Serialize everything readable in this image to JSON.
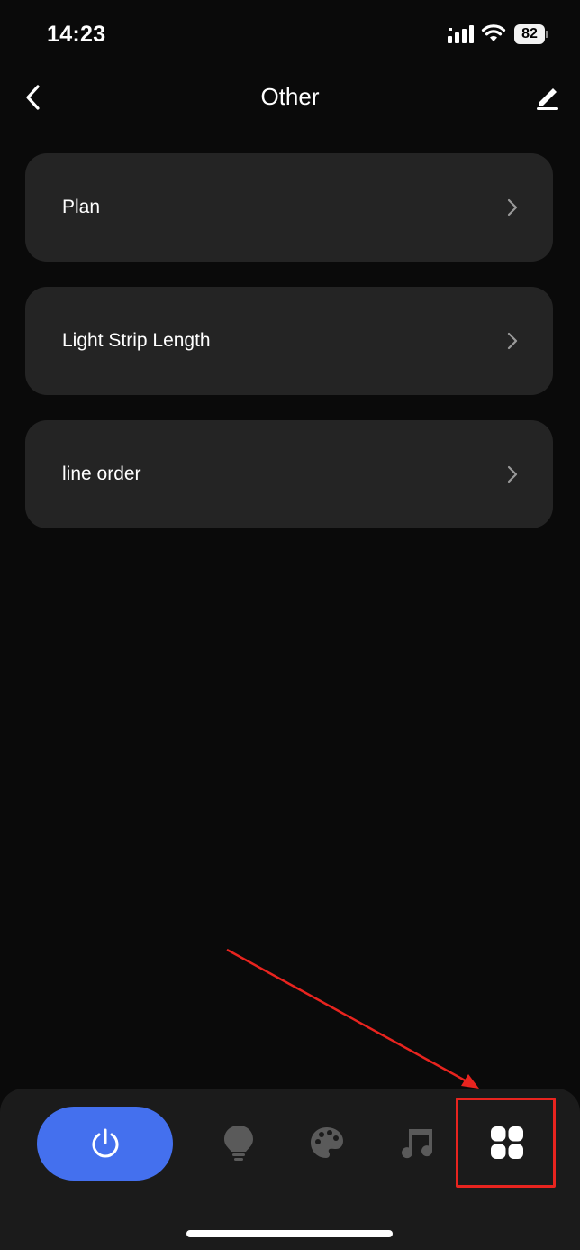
{
  "status_bar": {
    "time": "14:23",
    "battery_level": "82",
    "icons": [
      "signal-icon",
      "wifi-icon",
      "battery-icon"
    ]
  },
  "header": {
    "title": "Other",
    "back_icon": "chevron-left-icon",
    "edit_icon": "pencil-icon"
  },
  "menu": {
    "items": [
      {
        "label": "Plan"
      },
      {
        "label": "Light Strip Length"
      },
      {
        "label": "line order"
      }
    ]
  },
  "bottom_nav": {
    "tabs": [
      {
        "icon": "power-icon",
        "active": false
      },
      {
        "icon": "lightbulb-icon",
        "active": false
      },
      {
        "icon": "palette-icon",
        "active": false
      },
      {
        "icon": "music-note-icon",
        "active": false
      },
      {
        "icon": "grid-icon",
        "active": true
      }
    ]
  },
  "colors": {
    "background": "#0a0a0a",
    "card": "#242424",
    "nav_background": "#1b1b1b",
    "accent": "#4470ee",
    "inactive_icon": "#5a5a5a",
    "annotation": "#e8241f"
  }
}
